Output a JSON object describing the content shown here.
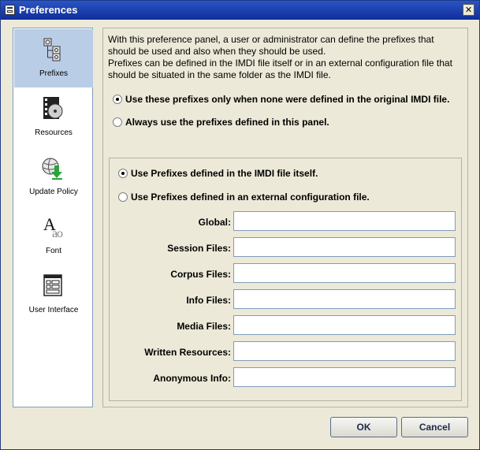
{
  "window": {
    "title": "Preferences",
    "close_glyph": "✕"
  },
  "sidebar": {
    "items": [
      {
        "label": "Prefixes",
        "icon": "prefixes-icon",
        "selected": true
      },
      {
        "label": "Resources",
        "icon": "film-disc-icon",
        "selected": false
      },
      {
        "label": "Update Policy",
        "icon": "globe-download-icon",
        "selected": false
      },
      {
        "label": "Font",
        "icon": "font-icon",
        "selected": false
      },
      {
        "label": "User Interface",
        "icon": "window-layout-icon",
        "selected": false
      }
    ]
  },
  "main": {
    "description": [
      "With this preference panel, a user or administrator can define the prefixes that",
      "should be used and also when they should be used.",
      "Prefixes can be defined in the IMDI file itself or in an external configuration file that",
      "should be situated in the same folder as the IMDI file."
    ],
    "usage_options": [
      {
        "label": "Use these prefixes only when none were defined in the original IMDI file.",
        "checked": true
      },
      {
        "label": "Always use the prefixes defined in this panel.",
        "checked": false
      }
    ],
    "source_options": [
      {
        "label": "Use Prefixes defined in the IMDI file itself.",
        "checked": true
      },
      {
        "label": "Use Prefixes defined in an external configuration file.",
        "checked": false
      }
    ],
    "fields": [
      {
        "label": "Global:",
        "value": ""
      },
      {
        "label": "Session Files:",
        "value": ""
      },
      {
        "label": "Corpus Files:",
        "value": ""
      },
      {
        "label": "Info Files:",
        "value": ""
      },
      {
        "label": "Media Files:",
        "value": ""
      },
      {
        "label": "Written Resources:",
        "value": ""
      },
      {
        "label": "Anonymous Info:",
        "value": ""
      }
    ]
  },
  "footer": {
    "ok_label": "OK",
    "cancel_label": "Cancel"
  },
  "colors": {
    "titlebar": "#0f2e9a",
    "selection": "#b9cde6",
    "background": "#ece9d8"
  }
}
